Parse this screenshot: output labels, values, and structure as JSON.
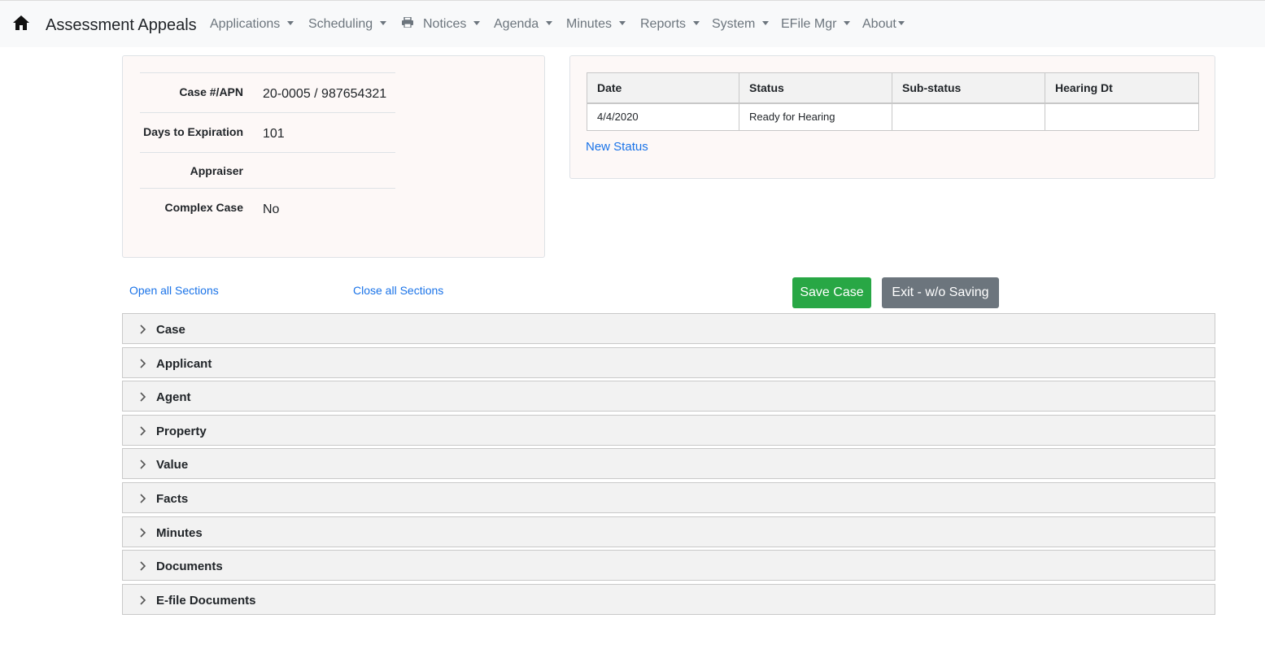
{
  "navbar": {
    "brand": "Assessment Appeals",
    "items": [
      {
        "label": "Applications"
      },
      {
        "label": "Scheduling"
      },
      {
        "label": "Notices"
      },
      {
        "label": "Agenda"
      },
      {
        "label": "Minutes"
      },
      {
        "label": "Reports"
      },
      {
        "label": "System"
      },
      {
        "label": "EFile Mgr"
      },
      {
        "label": "About"
      }
    ]
  },
  "case_info": {
    "rows": [
      {
        "label": "Case #/APN",
        "value": "20-0005 / 987654321"
      },
      {
        "label": "Days to Expiration",
        "value": "101"
      },
      {
        "label": "Appraiser",
        "value": ""
      },
      {
        "label": "Complex Case",
        "value": "No"
      }
    ]
  },
  "status_table": {
    "headers": [
      "Date",
      "Status",
      "Sub-status",
      "Hearing Dt"
    ],
    "rows": [
      [
        "4/4/2020",
        "Ready for Hearing",
        "",
        ""
      ]
    ],
    "new_status_label": "New Status"
  },
  "sections": {
    "open_all_label": "Open all Sections",
    "close_all_label": "Close all Sections",
    "save_label": "Save Case",
    "exit_label": "Exit - w/o Saving",
    "items": [
      {
        "label": "Case"
      },
      {
        "label": "Applicant"
      },
      {
        "label": "Agent"
      },
      {
        "label": "Property"
      },
      {
        "label": "Value"
      },
      {
        "label": "Facts"
      },
      {
        "label": "Minutes"
      },
      {
        "label": "Documents"
      },
      {
        "label": "E-file Documents"
      }
    ]
  }
}
